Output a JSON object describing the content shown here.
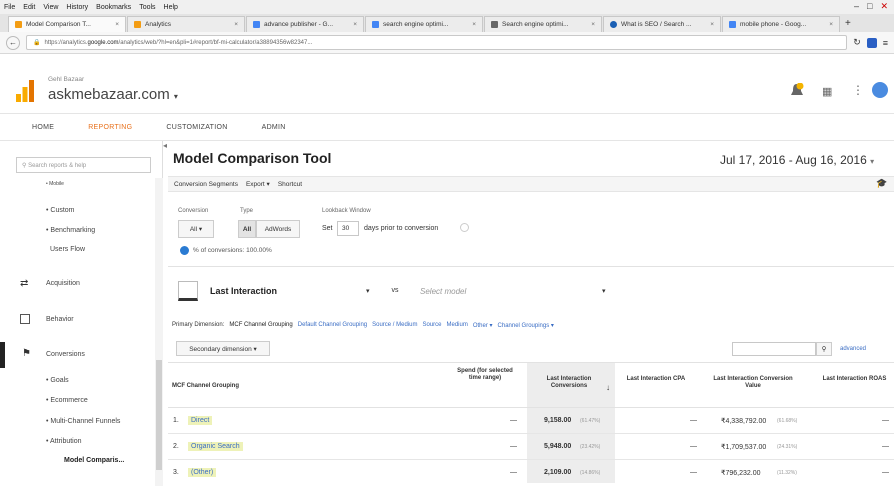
{
  "menu": [
    "File",
    "Edit",
    "View",
    "History",
    "Bookmarks",
    "Tools",
    "Help"
  ],
  "tabs": [
    {
      "label": "Model Comparison T...",
      "color": "#f39c12",
      "active": true
    },
    {
      "label": "Analytics",
      "color": "#f39c12",
      "active": false
    },
    {
      "label": "advance publisher - G...",
      "color": "#4285f4",
      "active": false
    },
    {
      "label": "search engine optimi...",
      "color": "#4285f4",
      "active": false
    },
    {
      "label": "Search engine optimi...",
      "color": "#666666",
      "active": false
    },
    {
      "label": "What is SEO / Search ...",
      "color": "#1a5fb4",
      "active": false
    },
    {
      "label": "mobile phone - Goog...",
      "color": "#4285f4",
      "active": false
    }
  ],
  "url": {
    "prefix": "https://analytics.",
    "domain": "google.com",
    "rest": "/analytics/web/?hl=en&pli=1#report/bf-mi-calculator/a38894356w82347..."
  },
  "account": {
    "property": "Gehl Bazaar",
    "name": "askmebazaar.com"
  },
  "nav": [
    "HOME",
    "REPORTING",
    "CUSTOMIZATION",
    "ADMIN"
  ],
  "nav_active": "REPORTING",
  "sidebar": {
    "search_placeholder": "Search reports & help",
    "items": [
      "• Mobile",
      "• Custom",
      "• Benchmarking",
      "Users Flow"
    ],
    "sections": [
      "Acquisition",
      "Behavior",
      "Conversions"
    ],
    "conv_items": [
      "• Goals",
      "• Ecommerce",
      "• Multi-Channel Funnels",
      "• Attribution",
      "Model Comparis..."
    ]
  },
  "page": {
    "title": "Model Comparison Tool",
    "date_range": "Jul 17, 2016 - Aug 16, 2016"
  },
  "toolbar": [
    "Conversion Segments",
    "Export ▾",
    "Shortcut"
  ],
  "controls": {
    "conversion_label": "Conversion",
    "conversion_value": "All ▾",
    "type_label": "Type",
    "type_all": "All",
    "type_adwords": "AdWords",
    "lookback_label": "Lookback Window",
    "lookback_prefix": "Set",
    "lookback_value": "30",
    "lookback_suffix": "days prior to conversion",
    "percent": "% of conversions: 100.00%"
  },
  "model": {
    "selected": "Last Interaction",
    "vs": "vs",
    "placeholder": "Select model"
  },
  "dimensions": {
    "label": "Primary Dimension:",
    "active": "MCF Channel Grouping",
    "links": [
      "Default Channel Grouping",
      "Source / Medium",
      "Source",
      "Medium",
      "Other ▾",
      "Channel Groupings ▾"
    ]
  },
  "secondary": "Secondary dimension ▾",
  "advanced": "advanced",
  "table": {
    "headers": [
      "MCF Channel Grouping",
      "Spend (for selected time range)",
      "Last Interaction Conversions",
      "Last Interaction CPA",
      "Last Interaction Conversion Value",
      "Last Interaction ROAS"
    ],
    "rows": [
      {
        "num": "1.",
        "name": "Direct",
        "spend": "—",
        "conv": "9,158.00",
        "conv_pct": "(61.47%)",
        "cpa": "—",
        "value": "₹4,338,792.00",
        "value_pct": "(61.68%)",
        "roas": "—"
      },
      {
        "num": "2.",
        "name": "Organic Search",
        "spend": "—",
        "conv": "5,948.00",
        "conv_pct": "(23.42%)",
        "cpa": "—",
        "value": "₹1,709,537.00",
        "value_pct": "(24.31%)",
        "roas": "—"
      },
      {
        "num": "3.",
        "name": "(Other)",
        "spend": "—",
        "conv": "2,109.00",
        "conv_pct": "(14.86%)",
        "cpa": "—",
        "value": "₹796,232.00",
        "value_pct": "(11.32%)",
        "roas": "—"
      }
    ]
  }
}
